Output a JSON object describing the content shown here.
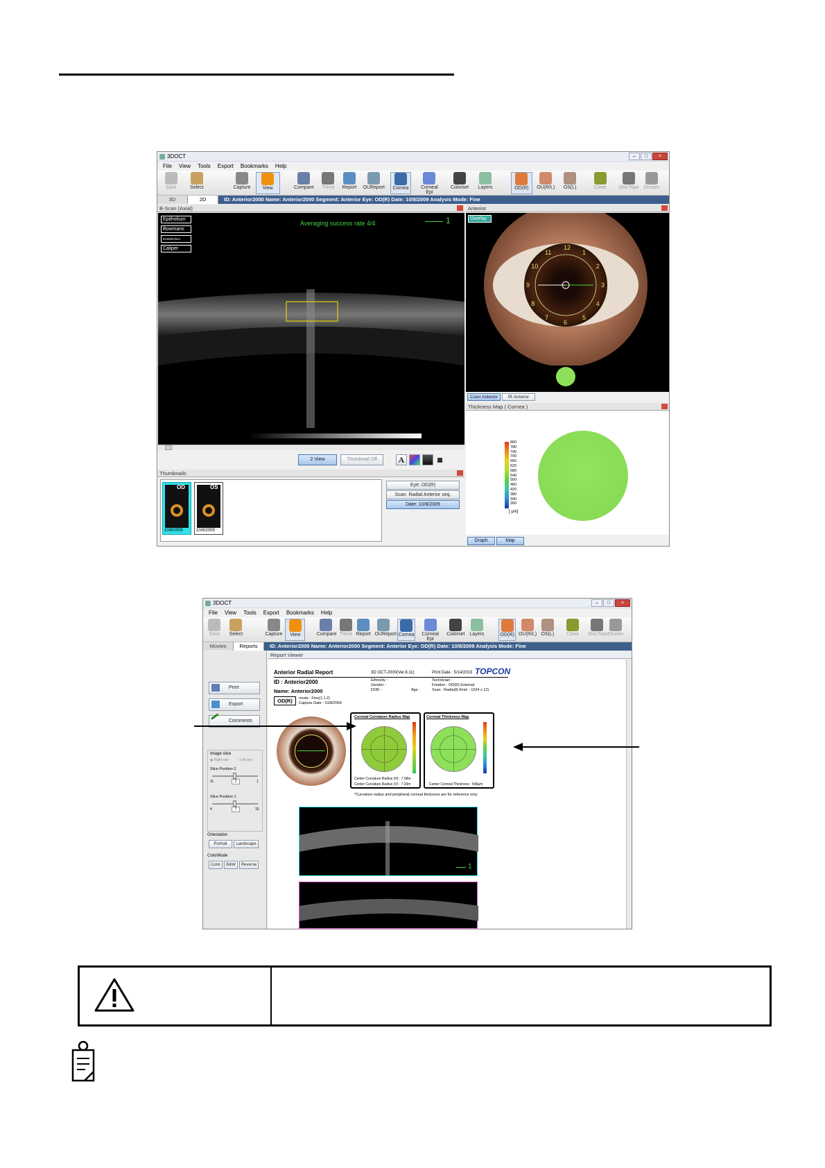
{
  "screen1": {
    "title": "3DOCT",
    "menu": [
      "File",
      "View",
      "Tools",
      "Export",
      "Bookmarks",
      "Help"
    ],
    "toolbar": [
      "Save",
      "Select",
      "Capture",
      "View",
      "Compare",
      "Trend",
      "Report",
      "OUReport",
      "Cornea",
      "Corneal Epi",
      "Colorset",
      "Layers",
      "OD(R)",
      "OU(R/L)",
      "OS(L)",
      "Close",
      "DiscTopo",
      "Drusen"
    ],
    "tabs": [
      "3D",
      "2D"
    ],
    "info": "ID: Anterior2000   Name: Anterior2000   Segment: Anterior   Eye: OD(R)   Date: 10/8/2009   Analysis Mode: Fine",
    "bscan_title": "B-Scan (Axial)",
    "layer_buttons": [
      "Epithelium",
      "Bowmans",
      "Endothelium",
      "Caliper"
    ],
    "averaging": "Averaging success rate  4/4",
    "marker": "1",
    "btn_2view": "2 View",
    "btn_thumboff": "Thumbnail Off",
    "font_btn": "A",
    "thumbnails_title": "Thumbnails",
    "thumb_labels": [
      "OD",
      "OS"
    ],
    "thumb_dates": [
      "10/8/2009",
      "10/8/2009"
    ],
    "thumb_eyebtns": [
      "Eye: OD(R)",
      "Scan: Radial Anterior seq.",
      "Date: 10/8/2009"
    ],
    "anterior_title": "Anterior",
    "overlay": "Overlay",
    "clock": [
      "1",
      "2",
      "3",
      "4",
      "5",
      "6",
      "7",
      "8",
      "9",
      "10",
      "11",
      "12"
    ],
    "ant_tabs": [
      "Color Anterior",
      "IR Anterior"
    ],
    "thickmap_title": "Thickness Map    ( Cornea )",
    "scale_values": [
      "800",
      "780",
      "740",
      "700",
      "660",
      "620",
      "580",
      "540",
      "500",
      "460",
      "420",
      "380",
      "340",
      "300"
    ],
    "scale_unit": "[ μm]",
    "map_tabs": [
      "Graph",
      "Map"
    ]
  },
  "screen2": {
    "title": "3DOCT",
    "menu": [
      "File",
      "View",
      "Tools",
      "Export",
      "Bookmarks",
      "Help"
    ],
    "toolbar": [
      "Save",
      "Select",
      "Capture",
      "View",
      "Compare",
      "Trend",
      "Report",
      "OUReport",
      "Cornea",
      "Corneal Epi",
      "Colorset",
      "Layers",
      "OD(R)",
      "OU(R/L)",
      "OS(L)",
      "Close",
      "DiscTopo",
      "Drusen"
    ],
    "tabs": [
      "Movies",
      "Reports"
    ],
    "info": "ID: Anterior2000   Name: Anterior2000   Segment: Anterior   Eye: OD(R)   Date: 10/8/2009   Analysis Mode: Fine",
    "viewer_title": "Report Viewer",
    "side_buttons": [
      "Print",
      "Export",
      "Comments"
    ],
    "image_slice": "Image slice",
    "radio": [
      "Right eye",
      "Left eye"
    ],
    "slice2": "Slice Position 2",
    "slice2_vals": [
      "11",
      "1",
      "1"
    ],
    "slice1": "Slice Position 1",
    "slice1_vals": [
      "4",
      "7",
      "10"
    ],
    "orientation": "Orientation",
    "orient_btns": [
      "Portrait",
      "Landscape"
    ],
    "colormode": "ColorMode",
    "color_btns": [
      "Color",
      "B&W",
      "Reverse"
    ],
    "report": {
      "title": "Anterior Radial Report",
      "version": "3D OCT-2000(Ver.8.11)",
      "print_date": "Print Date : 5/14/2013",
      "brand": "TOPCON",
      "id": "ID : Anterior2000",
      "name": "Name: Anterior2000",
      "ethnicity": "Ethnicity :",
      "gender": "Gender :",
      "dob": "DOB :",
      "age": "Age :",
      "technician": "Technician :",
      "fixation": "Fixation : OD(R) External",
      "scan": "Scan : Radial(6.0mm - 1024 x 12)",
      "eye": "OD(R)",
      "mode": "mode : Fine(1.1.2)",
      "capture": "Capture Date : 10/8/2009",
      "curv_title": "Corneal Curvature Radius Map",
      "thick_title": "Corneal Thickness Map",
      "curv_h": "Center Curvature Radius (H) : 7.58m",
      "curv_v": "Center Curvature Radius (V) : 7.33m",
      "thick_center": "Center Corneal Thickness : 546μm",
      "note": "*Curvature radius and peripheral corneal thickness are for reference only.",
      "marker": "1"
    }
  },
  "colors": {
    "accent_blue": "#3c5f8c",
    "map_green": "#8ee05a",
    "toolbar_orange": "#f0900f",
    "highlight_cyan": "#35e0e8"
  }
}
